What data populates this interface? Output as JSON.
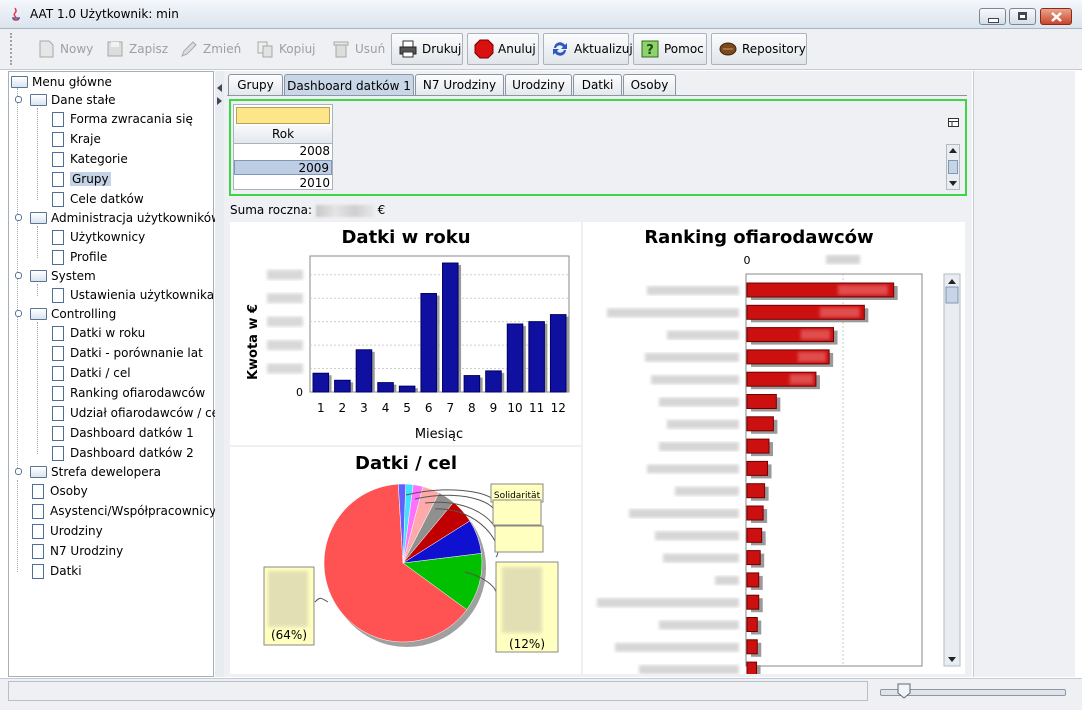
{
  "window": {
    "title": "AAT 1.0  Użytkownik: min"
  },
  "toolbar": {
    "buttons": [
      {
        "label": "Nowy",
        "icon": "new-icon",
        "enabled": false
      },
      {
        "label": "Zapisz",
        "icon": "save-icon",
        "enabled": false
      },
      {
        "label": "Zmień",
        "icon": "edit-icon",
        "enabled": false
      },
      {
        "label": "Kopiuj",
        "icon": "copy-icon",
        "enabled": false
      },
      {
        "label": "Usuń",
        "icon": "trash-icon",
        "enabled": false
      },
      {
        "label": "Drukuj",
        "icon": "printer-icon",
        "enabled": true
      },
      {
        "label": "Anuluj",
        "icon": "stop-icon",
        "enabled": true
      },
      {
        "label": "Aktualizuj",
        "icon": "refresh-icon",
        "enabled": true
      },
      {
        "label": "Pomoc",
        "icon": "help-icon",
        "enabled": true
      },
      {
        "label": "Repository",
        "icon": "repository-icon",
        "enabled": true
      }
    ]
  },
  "tree": {
    "root": "Menu główne",
    "groups": [
      {
        "label": "Dane stałe",
        "items": [
          "Forma zwracania się",
          "Kraje",
          "Kategorie",
          "Grupy",
          "Cele datków"
        ]
      },
      {
        "label": "Administracja użytkowników",
        "items": [
          "Użytkownicy",
          "Profile"
        ]
      },
      {
        "label": "System",
        "items": [
          "Ustawienia użytkownika"
        ]
      },
      {
        "label": "Controlling",
        "items": [
          "Datki w roku",
          "Datki - porównanie lat",
          "Datki / cel",
          "Ranking ofiarodawców",
          "Udział ofiarodawców / cel",
          "Dashboard datków 1",
          "Dashboard datków 2"
        ]
      },
      {
        "label": "Strefa dewelopera",
        "items": [
          "Osoby",
          "Asystenci/Współpracownicy",
          "Urodziny",
          "N7 Urodziny",
          "Datki"
        ]
      }
    ],
    "selected": "Grupy"
  },
  "tabs": [
    {
      "label": "Grupy",
      "active": false
    },
    {
      "label": "Dashboard datków 1",
      "active": true
    },
    {
      "label": "N7 Urodziny",
      "active": false
    },
    {
      "label": "Urodziny",
      "active": false
    },
    {
      "label": "Datki",
      "active": false
    },
    {
      "label": "Osoby",
      "active": false
    }
  ],
  "year_table": {
    "header": "Rok",
    "rows": [
      "2008",
      "2009",
      "2010"
    ],
    "selected": "2009"
  },
  "summary": {
    "label": "Suma roczna:",
    "currency": "€"
  },
  "colors": {
    "bar": "#1010a0",
    "ranking_bar": "#cc1010",
    "accent_green": "#3dd645"
  },
  "chart_data": [
    {
      "type": "bar",
      "title": "Datki w roku",
      "xlabel": "Miesiąc",
      "ylabel": "Kwota w €",
      "categories": [
        "1",
        "2",
        "3",
        "4",
        "5",
        "6",
        "7",
        "8",
        "9",
        "10",
        "11",
        "12"
      ],
      "values": [
        8,
        5,
        18,
        4,
        2.5,
        42,
        55,
        7,
        9,
        29,
        30,
        33
      ],
      "ylim": [
        0,
        58
      ],
      "y_tick_labels": [
        "0"
      ],
      "grid": true
    },
    {
      "type": "pie",
      "title": "Datki / cel",
      "slices": [
        {
          "label": "(64%)",
          "value": 64,
          "color": "#ff5252"
        },
        {
          "label": "(12%)",
          "value": 12,
          "color": "#00c000"
        },
        {
          "label": "",
          "value": 7,
          "color": "#1010d0"
        },
        {
          "label": "",
          "value": 5,
          "color": "#c00000"
        },
        {
          "label": "",
          "value": 3.5,
          "color": "#909090"
        },
        {
          "label": "",
          "value": 3.5,
          "color": "#ffaaaa"
        },
        {
          "label": "",
          "value": 2,
          "color": "#ff70ff"
        },
        {
          "label": "",
          "value": 1.5,
          "color": "#40e0ff"
        },
        {
          "label": "",
          "value": 1.5,
          "color": "#6060ff"
        }
      ],
      "callout_partial": "Solidarität"
    },
    {
      "type": "bar",
      "orientation": "horizontal",
      "title": "Ranking ofiarodawców",
      "x_tick_labels": [
        "0"
      ],
      "values": [
        100,
        80,
        59,
        56,
        47,
        20,
        18,
        15,
        14,
        12,
        11,
        10,
        9,
        8,
        8,
        7,
        7,
        6.5
      ],
      "xlim": [
        0,
        120
      ]
    }
  ]
}
